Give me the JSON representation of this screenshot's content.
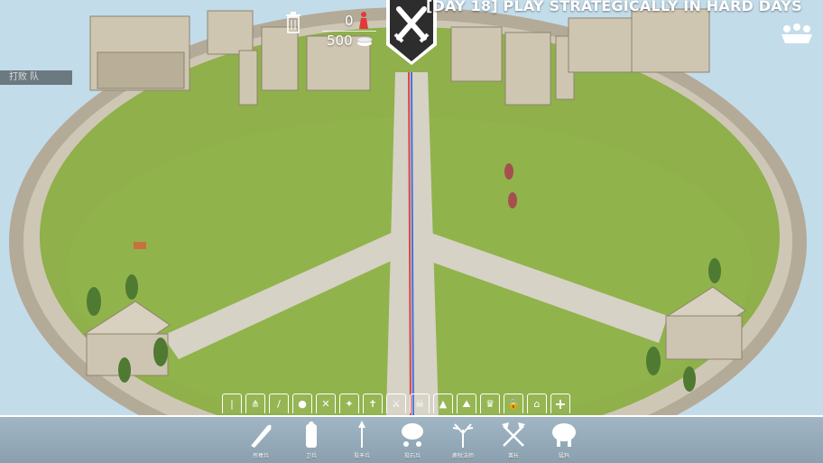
{
  "hud": {
    "title": "[DAY 18] PLAY STRATEGICALLY IN HARD DAYS",
    "unit_count": "0",
    "money": "500",
    "team_label": "打败 队"
  },
  "faction_tabs": [
    "tribal-icon",
    "farmer-icon",
    "sword-icon",
    "shield-icon",
    "axe-icon",
    "star-icon",
    "cross-icon",
    "swords-icon",
    "skull-icon",
    "pyramid-icon",
    "mountain-icon",
    "crown-icon",
    "lock-icon",
    "temple-icon",
    "+"
  ],
  "units": [
    {
      "label": "挥棒兵",
      "icon": "club-icon"
    },
    {
      "label": "卫兵",
      "icon": "shield-warrior-icon"
    },
    {
      "label": "投矛兵",
      "icon": "spear-icon"
    },
    {
      "label": "投石兵",
      "icon": "stone-thrower-icon"
    },
    {
      "label": "鹿杖法师",
      "icon": "antler-staff-icon"
    },
    {
      "label": "酋长",
      "icon": "crossed-axes-icon"
    },
    {
      "label": "猛犸",
      "icon": "mammoth-icon"
    }
  ],
  "colors": {
    "grass": "#8fb04a",
    "wall": "#c8c0b0",
    "path": "#d6d2c6",
    "red_team": "#d8474a",
    "blue_team": "#4a6fd8"
  }
}
